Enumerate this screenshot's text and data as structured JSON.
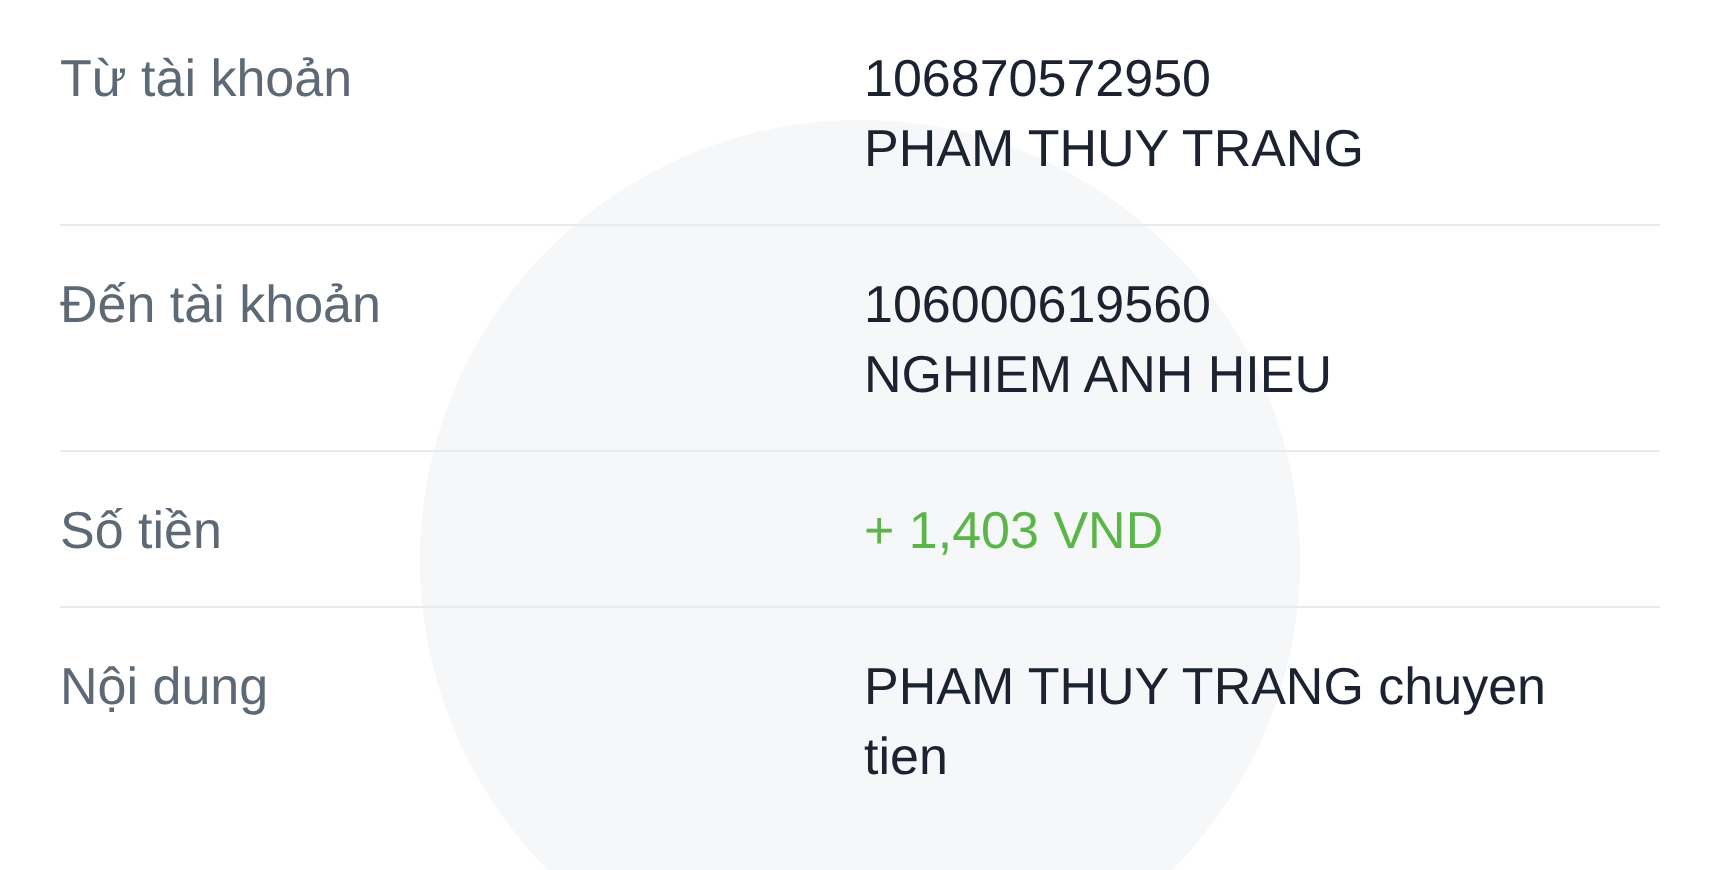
{
  "rows": [
    {
      "label": "Từ tài khoản",
      "kind": "plain",
      "lines": [
        "106870572950",
        "PHAM THUY TRANG"
      ]
    },
    {
      "label": "Đến tài khoản",
      "kind": "plain",
      "lines": [
        "106000619560",
        "NGHIEM ANH HIEU"
      ]
    },
    {
      "label": "Số tiền",
      "kind": "amount",
      "lines": [
        "+ 1,403 VND"
      ]
    },
    {
      "label": "Nội dung",
      "kind": "plain",
      "lines": [
        "PHAM THUY TRANG chuyen tien"
      ]
    }
  ]
}
